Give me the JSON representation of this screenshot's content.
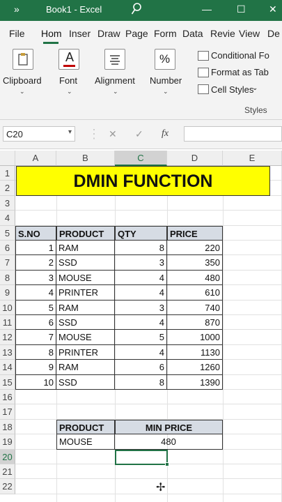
{
  "titlebar": {
    "more": "»",
    "title": "Book1  -  Excel",
    "search_icon": "search-icon",
    "minimize": "—",
    "maximize": "☐",
    "close": "✕"
  },
  "tabs": [
    "File",
    "Hom",
    "Inser",
    "Draw",
    "Page",
    "Form",
    "Data",
    "Revie",
    "View",
    "De"
  ],
  "ribbon": {
    "clipboard": "Clipboard",
    "font": "Font",
    "alignment": "Alignment",
    "number": "Number",
    "number_icon": "%",
    "font_icon": "A",
    "conditional": "Conditional Fo",
    "format_table": "Format as Tab",
    "cell_styles": "Cell Styles",
    "styles_group": "Styles"
  },
  "formula_bar": {
    "name_box": "C20",
    "cancel": "✕",
    "enter": "✓",
    "fx": "fx",
    "value": ""
  },
  "columns": [
    "A",
    "B",
    "C",
    "D",
    "E"
  ],
  "rows": [
    "1",
    "2",
    "3",
    "4",
    "5",
    "6",
    "7",
    "8",
    "9",
    "10",
    "11",
    "12",
    "13",
    "14",
    "15",
    "16",
    "17",
    "18",
    "19",
    "20",
    "21",
    "22"
  ],
  "sheet": {
    "banner": "DMIN FUNCTION",
    "table_headers": [
      "S.NO",
      "PRODUCT",
      "QTY",
      "PRICE"
    ],
    "table_rows": [
      [
        "1",
        "RAM",
        "8",
        "220"
      ],
      [
        "2",
        "SSD",
        "3",
        "350"
      ],
      [
        "3",
        "MOUSE",
        "4",
        "480"
      ],
      [
        "4",
        "PRINTER",
        "4",
        "610"
      ],
      [
        "5",
        "RAM",
        "3",
        "740"
      ],
      [
        "6",
        "SSD",
        "4",
        "870"
      ],
      [
        "7",
        "MOUSE",
        "5",
        "1000"
      ],
      [
        "8",
        "PRINTER",
        "4",
        "1130"
      ],
      [
        "9",
        "RAM",
        "6",
        "1260"
      ],
      [
        "10",
        "SSD",
        "8",
        "1390"
      ]
    ],
    "criteria_headers": [
      "PRODUCT",
      "MIN PRICE"
    ],
    "criteria_values": [
      "MOUSE",
      "480"
    ]
  },
  "colors": {
    "excel_green": "#217346",
    "banner_yellow": "#ffff00",
    "header_fill": "#d6dce4"
  }
}
